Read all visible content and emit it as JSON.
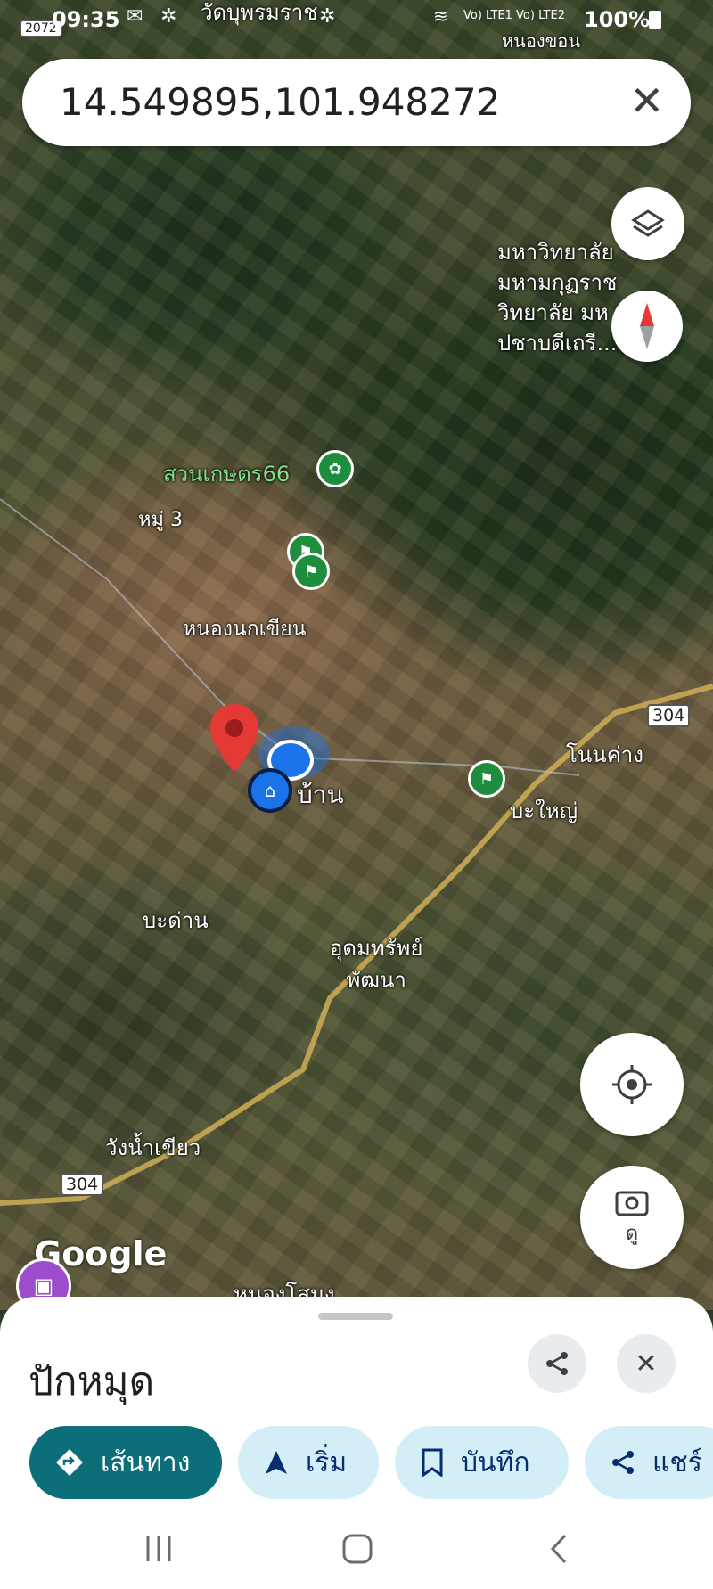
{
  "status_bar": {
    "time": "09:35",
    "network": "Vo) LTE1  Vo) LTE2",
    "battery": "100%"
  },
  "search": {
    "query": "14.549895,101.948272"
  },
  "map": {
    "labels": {
      "wat": "วัดบุพรมราช",
      "nong_khon": "หนองขอน",
      "university": [
        "มหาวิทยาลัย",
        "มหามกุฏราช",
        "วิทยาลัย มห",
        "ปชาบดีเถรี..."
      ],
      "garden": "สวนเกษตร66",
      "moo3": "หมู่ 3",
      "nong_nok_khian": "หนองนกเขียน",
      "ban": "บ้าน",
      "non_khang": "โนนค่าง",
      "ba_yai": "บะใหญ่",
      "ba_dan": "บะด่าน",
      "udom_sap": [
        "อุดมทรัพย์",
        "พัฒนา"
      ],
      "wang_nam_khiao": "วังน้ำเขียว",
      "nong_samong": "หนองโสมง"
    },
    "shields": {
      "top_left": "2072",
      "road_east": "304",
      "road_west": "304"
    },
    "attribution": "Google",
    "look_button_label": "ดู"
  },
  "sheet": {
    "title": "ปักหมุด",
    "chips": [
      {
        "label": "เส้นทาง"
      },
      {
        "label": "เริ่ม"
      },
      {
        "label": "บันทึก"
      },
      {
        "label": "แชร์"
      }
    ]
  },
  "colors": {
    "primary_chip": "#0b6e78",
    "chip": "#d4eef7",
    "pin": "#e53935",
    "poi_green": "#1e8e3e",
    "home_blue": "#1a73e8"
  }
}
